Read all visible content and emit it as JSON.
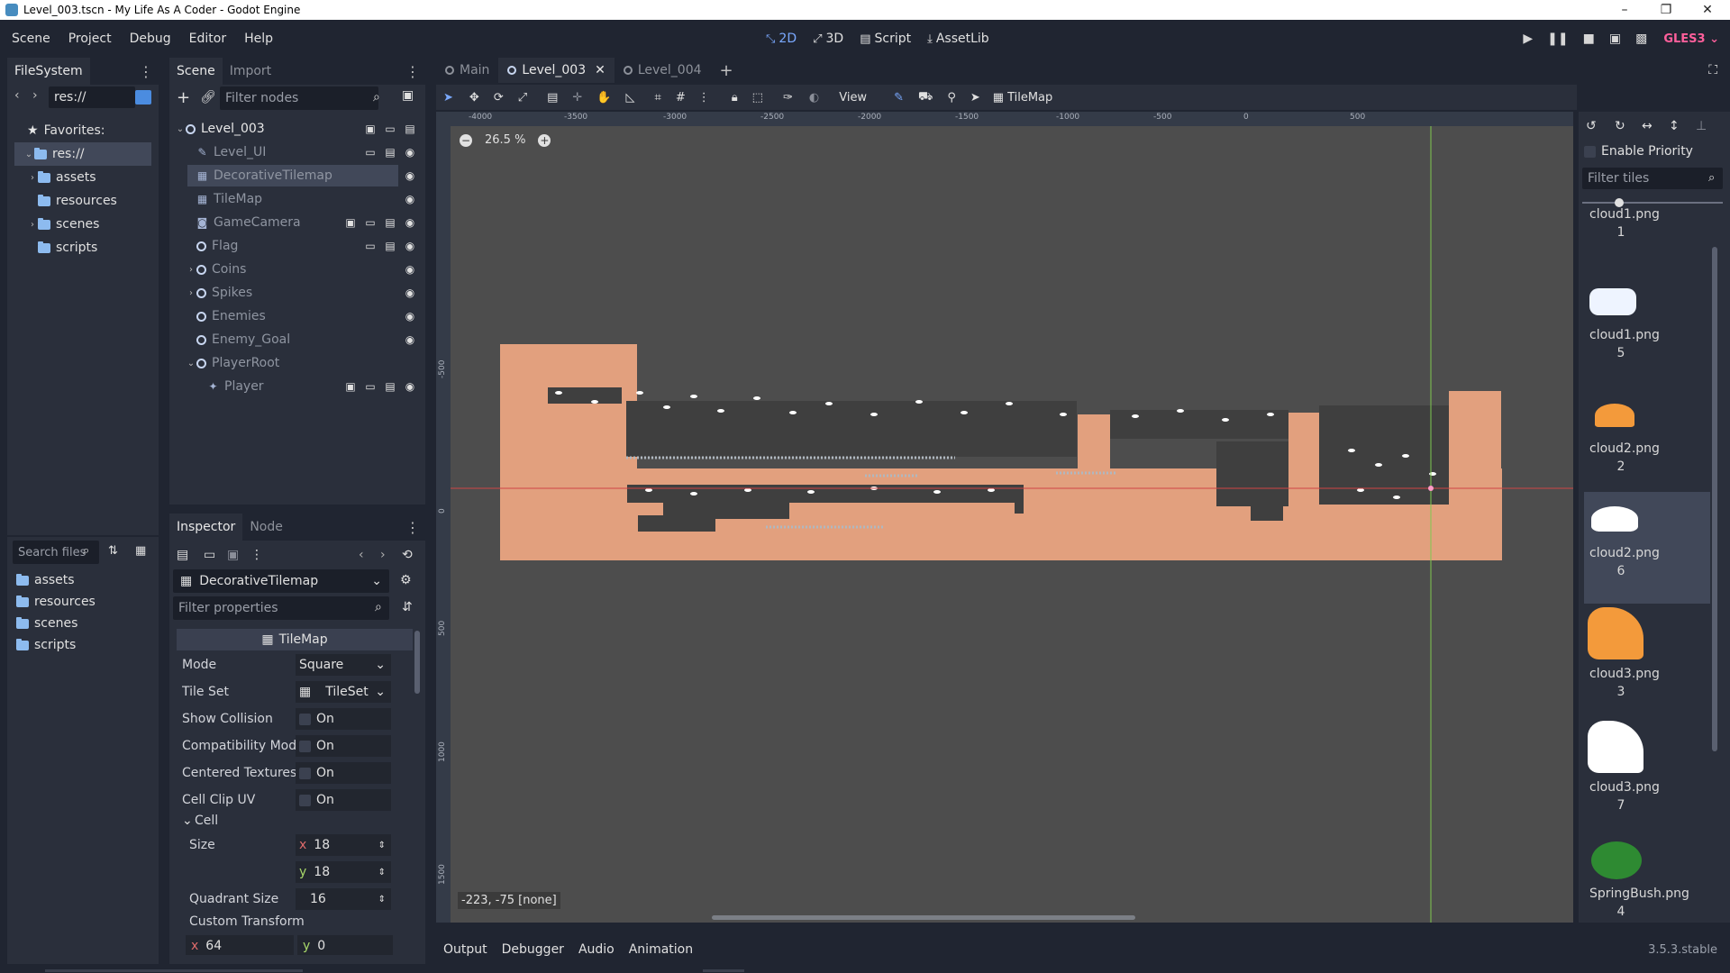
{
  "window": {
    "title": "Level_003.tscn - My Life As A Coder - Godot Engine"
  },
  "menu": [
    "Scene",
    "Project",
    "Debug",
    "Editor",
    "Help"
  ],
  "workspaces": [
    {
      "label": "2D",
      "icon": "2d-icon",
      "active": true
    },
    {
      "label": "3D",
      "icon": "3d-icon",
      "active": false
    },
    {
      "label": "Script",
      "icon": "script-icon",
      "active": false
    },
    {
      "label": "AssetLib",
      "icon": "assetlib-icon",
      "active": false
    }
  ],
  "renderer": "GLES3",
  "filesystem": {
    "tab": "FileSystem",
    "path": "res://",
    "favorites_label": "Favorites:",
    "root": "res://",
    "tree": [
      "assets",
      "resources",
      "scenes",
      "scripts"
    ],
    "search_placeholder": "Search files",
    "list": [
      "assets",
      "resources",
      "scenes",
      "scripts"
    ]
  },
  "scene_dock": {
    "tabs": [
      "Scene",
      "Import"
    ],
    "filter_placeholder": "Filter nodes",
    "nodes": [
      {
        "name": "Level_003",
        "depth": 0,
        "type": "node2d",
        "root": true
      },
      {
        "name": "Level_UI",
        "depth": 1,
        "type": "canvas"
      },
      {
        "name": "DecorativeTilemap",
        "depth": 1,
        "type": "tilemap",
        "selected": true
      },
      {
        "name": "TileMap",
        "depth": 1,
        "type": "tilemap"
      },
      {
        "name": "GameCamera",
        "depth": 1,
        "type": "camera"
      },
      {
        "name": "Flag",
        "depth": 1,
        "type": "node2d"
      },
      {
        "name": "Coins",
        "depth": 1,
        "type": "node2d",
        "collapsed": true
      },
      {
        "name": "Spikes",
        "depth": 1,
        "type": "node2d",
        "collapsed": true
      },
      {
        "name": "Enemies",
        "depth": 1,
        "type": "node2d"
      },
      {
        "name": "Enemy_Goal",
        "depth": 1,
        "type": "node2d"
      },
      {
        "name": "PlayerRoot",
        "depth": 1,
        "type": "node2d",
        "expanded": true
      },
      {
        "name": "Player",
        "depth": 2,
        "type": "kinematic"
      }
    ]
  },
  "inspector": {
    "tabs": [
      "Inspector",
      "Node"
    ],
    "object": "DecorativeTilemap",
    "filter_placeholder": "Filter properties",
    "class_header": "TileMap",
    "props": {
      "mode_label": "Mode",
      "mode_value": "Square",
      "tileset_label": "Tile Set",
      "tileset_value": "TileSet",
      "show_collision_label": "Show Collision",
      "show_collision_value": "On",
      "compat_label": "Compatibility Mod",
      "compat_value": "On",
      "centered_label": "Centered Textures",
      "centered_value": "On",
      "clipuv_label": "Cell Clip UV",
      "clipuv_value": "On",
      "cell_section": "Cell",
      "size_label": "Size",
      "size_x": "18",
      "size_y": "18",
      "quadrant_label": "Quadrant Size",
      "quadrant_value": "16",
      "custom_transform_label": "Custom Transform",
      "ct_x": "64",
      "ct_y": "0",
      "x_axis": "x",
      "y_axis": "y"
    }
  },
  "editor_tabs": [
    {
      "label": "Main",
      "active": false
    },
    {
      "label": "Level_003",
      "active": true
    },
    {
      "label": "Level_004",
      "active": false
    }
  ],
  "toolbar": {
    "view_label": "View",
    "tilemap_label": "TileMap"
  },
  "viewport": {
    "zoom": "26.5 %",
    "status": "-223, -75 [none]",
    "ruler_top": [
      "-4000",
      "-3500",
      "-3000",
      "-2500",
      "-2000",
      "-1500",
      "-1000",
      "-500",
      "0",
      "500"
    ],
    "ruler_left": [
      "-500",
      "0",
      "500",
      "1000",
      "1500"
    ]
  },
  "tile_panel": {
    "enable_priority": "Enable Priority",
    "filter_placeholder": "Filter tiles",
    "tiles": [
      {
        "label": "cloud1.png 1",
        "color": "#ffffff"
      },
      {
        "label": "cloud1.png 5",
        "color": "#eef4ff"
      },
      {
        "label": "cloud2.png 2",
        "color": "#f39a3b"
      },
      {
        "label": "cloud2.png 6",
        "color": "#ffffff",
        "selected": true
      },
      {
        "label": "cloud3.png 3",
        "color": "#f39a3b"
      },
      {
        "label": "cloud3.png 7",
        "color": "#ffffff"
      },
      {
        "label": "SpringBush.png 4",
        "color": "#2e8a32"
      }
    ]
  },
  "bottom_panel": [
    "Output",
    "Debugger",
    "Audio",
    "Animation"
  ],
  "version": "3.5.3.stable",
  "colors": {
    "level_fill": "#e2a07e",
    "cave": "#3f3f3f",
    "viewport_bg": "#4d4d4d",
    "accent": "#7aa9ff"
  }
}
